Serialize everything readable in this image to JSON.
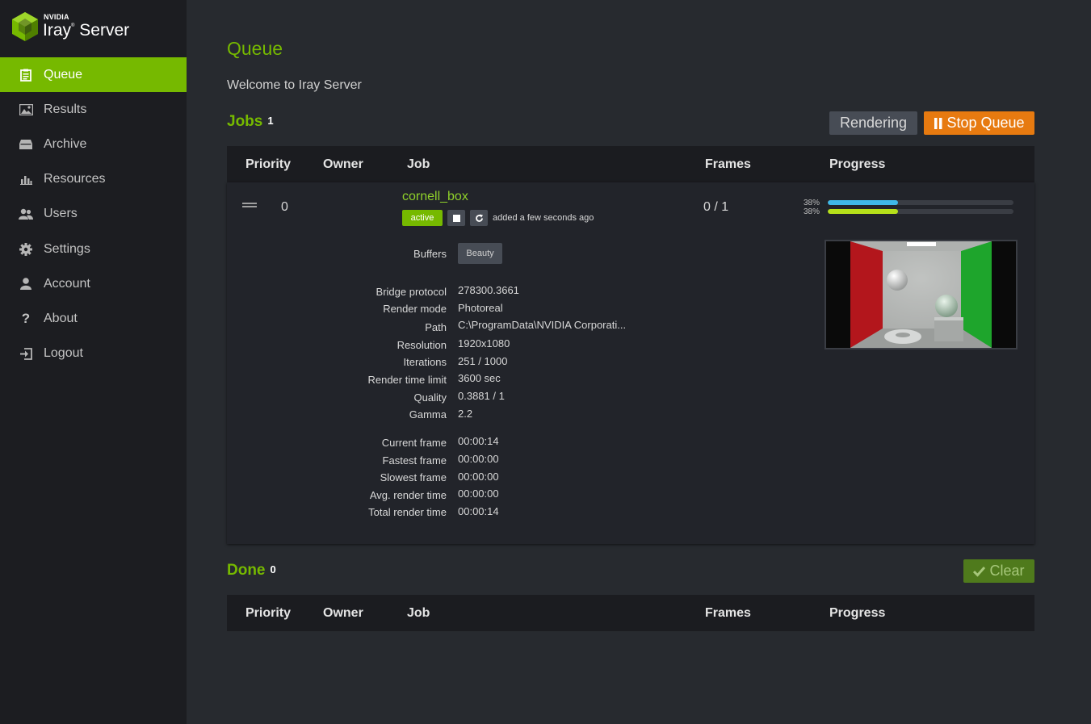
{
  "app": {
    "brand": "NVIDIA",
    "product": "Iray",
    "product_suffix": "Server",
    "accent_color": "#76b900"
  },
  "sidebar": {
    "items": [
      {
        "label": "Queue",
        "icon": "clipboard-icon",
        "active": true
      },
      {
        "label": "Results",
        "icon": "image-icon",
        "active": false
      },
      {
        "label": "Archive",
        "icon": "archive-icon",
        "active": false
      },
      {
        "label": "Resources",
        "icon": "bar-chart-icon",
        "active": false
      },
      {
        "label": "Users",
        "icon": "users-icon",
        "active": false
      },
      {
        "label": "Settings",
        "icon": "gear-icon",
        "active": false
      },
      {
        "label": "Account",
        "icon": "user-icon",
        "active": false
      },
      {
        "label": "About",
        "icon": "question-icon",
        "active": false
      },
      {
        "label": "Logout",
        "icon": "logout-icon",
        "active": false
      }
    ]
  },
  "main": {
    "title": "Queue",
    "welcome": "Welcome to Iray Server",
    "jobs": {
      "title": "Jobs",
      "count": "1",
      "rendering_label": "Rendering",
      "stop_label": "Stop Queue",
      "columns": [
        "Priority",
        "Owner",
        "Job",
        "Frames",
        "Progress"
      ]
    },
    "job": {
      "priority": "0",
      "owner": "",
      "name": "cornell_box",
      "status": "active",
      "added": "added a few seconds ago",
      "frames": "0 / 1",
      "progress": [
        {
          "pct_label": "38%",
          "value": 0.38,
          "color": "#3fb8e8"
        },
        {
          "pct_label": "38%",
          "value": 0.38,
          "color": "#b6e01a"
        }
      ],
      "buffers_label": "Buffers",
      "buffer": "Beauty",
      "properties": [
        {
          "label": "Bridge protocol",
          "value": "278300.3661"
        },
        {
          "label": "Render mode",
          "value": "Photoreal"
        },
        {
          "label": "Path",
          "value": "C:\\ProgramData\\NVIDIA Corporati..."
        },
        {
          "label": "Resolution",
          "value": "1920x1080"
        },
        {
          "label": "Iterations",
          "value": "251 / 1000"
        },
        {
          "label": "Render time limit",
          "value": "3600 sec"
        },
        {
          "label": "Quality",
          "value": "0.3881 / 1"
        },
        {
          "label": "Gamma",
          "value": "2.2"
        }
      ],
      "timings": [
        {
          "label": "Current frame",
          "value": "00:00:14"
        },
        {
          "label": "Fastest frame",
          "value": "00:00:00"
        },
        {
          "label": "Slowest frame",
          "value": "00:00:00"
        },
        {
          "label": "Avg. render time",
          "value": "00:00:00"
        },
        {
          "label": "Total render time",
          "value": "00:00:14"
        }
      ]
    },
    "done": {
      "title": "Done",
      "count": "0",
      "clear_label": "Clear",
      "columns": [
        "Priority",
        "Owner",
        "Job",
        "Frames",
        "Progress"
      ]
    }
  }
}
